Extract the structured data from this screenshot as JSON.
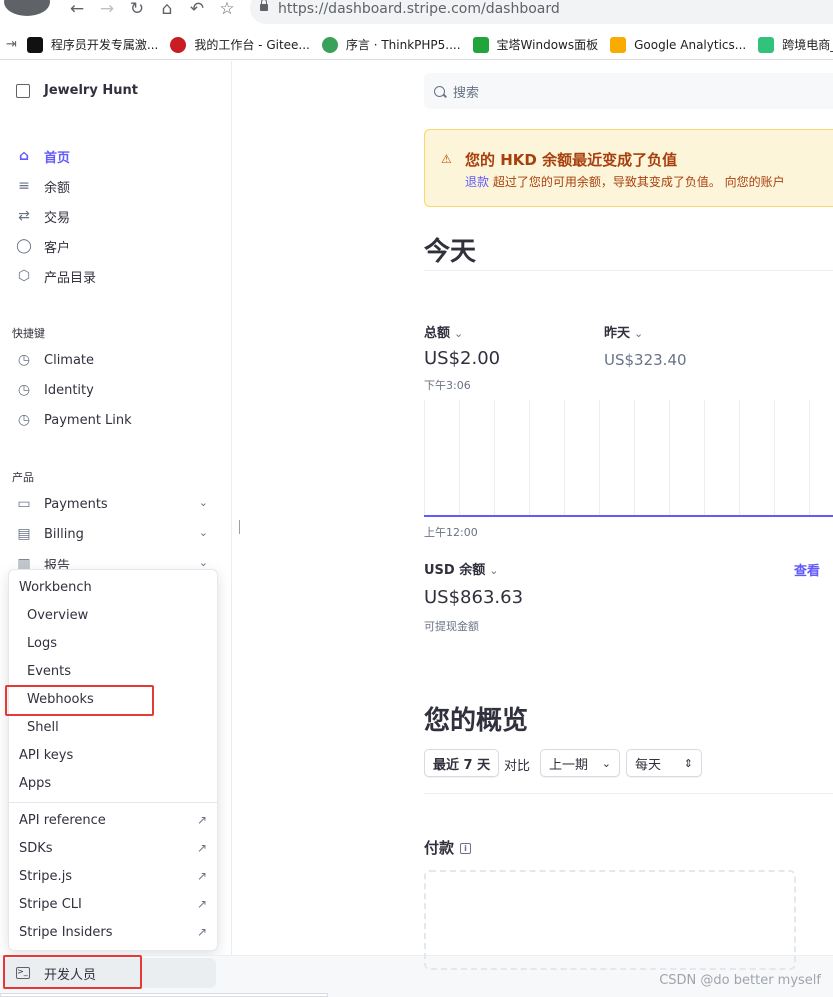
{
  "browser": {
    "url_host": "https://dashboard.stripe.com",
    "url_path": "/dashboard",
    "bookmarks": [
      {
        "label": "程序员开发专属激...",
        "color": "#111111"
      },
      {
        "label": "我的工作台 - Gitee...",
        "color": "#c71d23"
      },
      {
        "label": "序言 · ThinkPHP5....",
        "color": "#3aa15b"
      },
      {
        "label": "宝塔Windows面板",
        "color": "#20a53a"
      },
      {
        "label": "Google Analytics...",
        "color": "#f9ab00"
      },
      {
        "label": "跨境电商_",
        "color": "#31c27c"
      }
    ]
  },
  "sidebar": {
    "account": "Jewelry Hunt",
    "main": [
      {
        "label": "首页",
        "icon": "home-icon",
        "glyph": "⌂"
      },
      {
        "label": "余额",
        "icon": "balance-icon",
        "glyph": "≡"
      },
      {
        "label": "交易",
        "icon": "transactions-icon",
        "glyph": "⇄"
      },
      {
        "label": "客户",
        "icon": "customer-icon",
        "glyph": "◯"
      },
      {
        "label": "产品目录",
        "icon": "product-icon",
        "glyph": "⬡"
      }
    ],
    "shortcuts_label": "快捷键",
    "shortcuts": [
      {
        "label": "Climate",
        "icon": "clock-icon",
        "glyph": "◷"
      },
      {
        "label": "Identity",
        "icon": "clock-icon",
        "glyph": "◷"
      },
      {
        "label": "Payment Link",
        "icon": "clock-icon",
        "glyph": "◷"
      }
    ],
    "products_label": "产品",
    "products": [
      {
        "label": "Payments",
        "icon": "payments-icon",
        "glyph": "▭"
      },
      {
        "label": "Billing",
        "icon": "billing-icon",
        "glyph": "▤"
      },
      {
        "label": "报告",
        "icon": "reports-icon",
        "glyph": "▥"
      }
    ],
    "developer": "开发人员"
  },
  "popup": {
    "workbench": "Workbench",
    "sub": [
      "Overview",
      "Logs",
      "Events",
      "Webhooks",
      "Shell"
    ],
    "api_keys": "API keys",
    "apps": "Apps",
    "external": [
      "API reference",
      "SDKs",
      "Stripe.js",
      "Stripe CLI",
      "Stripe Insiders"
    ]
  },
  "main": {
    "search_placeholder": "搜索",
    "alert": {
      "title": "您的 HKD 余额最近变成了负值",
      "link": "退款",
      "body": " 超过了您的可用余额，导致其变成了负值。 向您的账户"
    },
    "today": "今天",
    "total_label": "总额",
    "total_value": "US$2.00",
    "total_time": "下午3:06",
    "yesterday_label": "昨天",
    "yesterday_value": "US$323.40",
    "chart_start": "上午12:00",
    "usd_balance_label": "USD 余额",
    "view_link": "查看",
    "usd_balance_value": "US$863.63",
    "available_label": "可提现金额",
    "overview_title": "您的概览",
    "range_btn": "最近 7 天",
    "compare_label": "对比",
    "period_btn": "上一期",
    "interval_btn": "每天",
    "payments_title": "付款"
  },
  "watermark": "CSDN @do better myself",
  "colors": {
    "accent": "#625afa",
    "alert_text": "#a8400e",
    "highlight": "#e53935"
  }
}
